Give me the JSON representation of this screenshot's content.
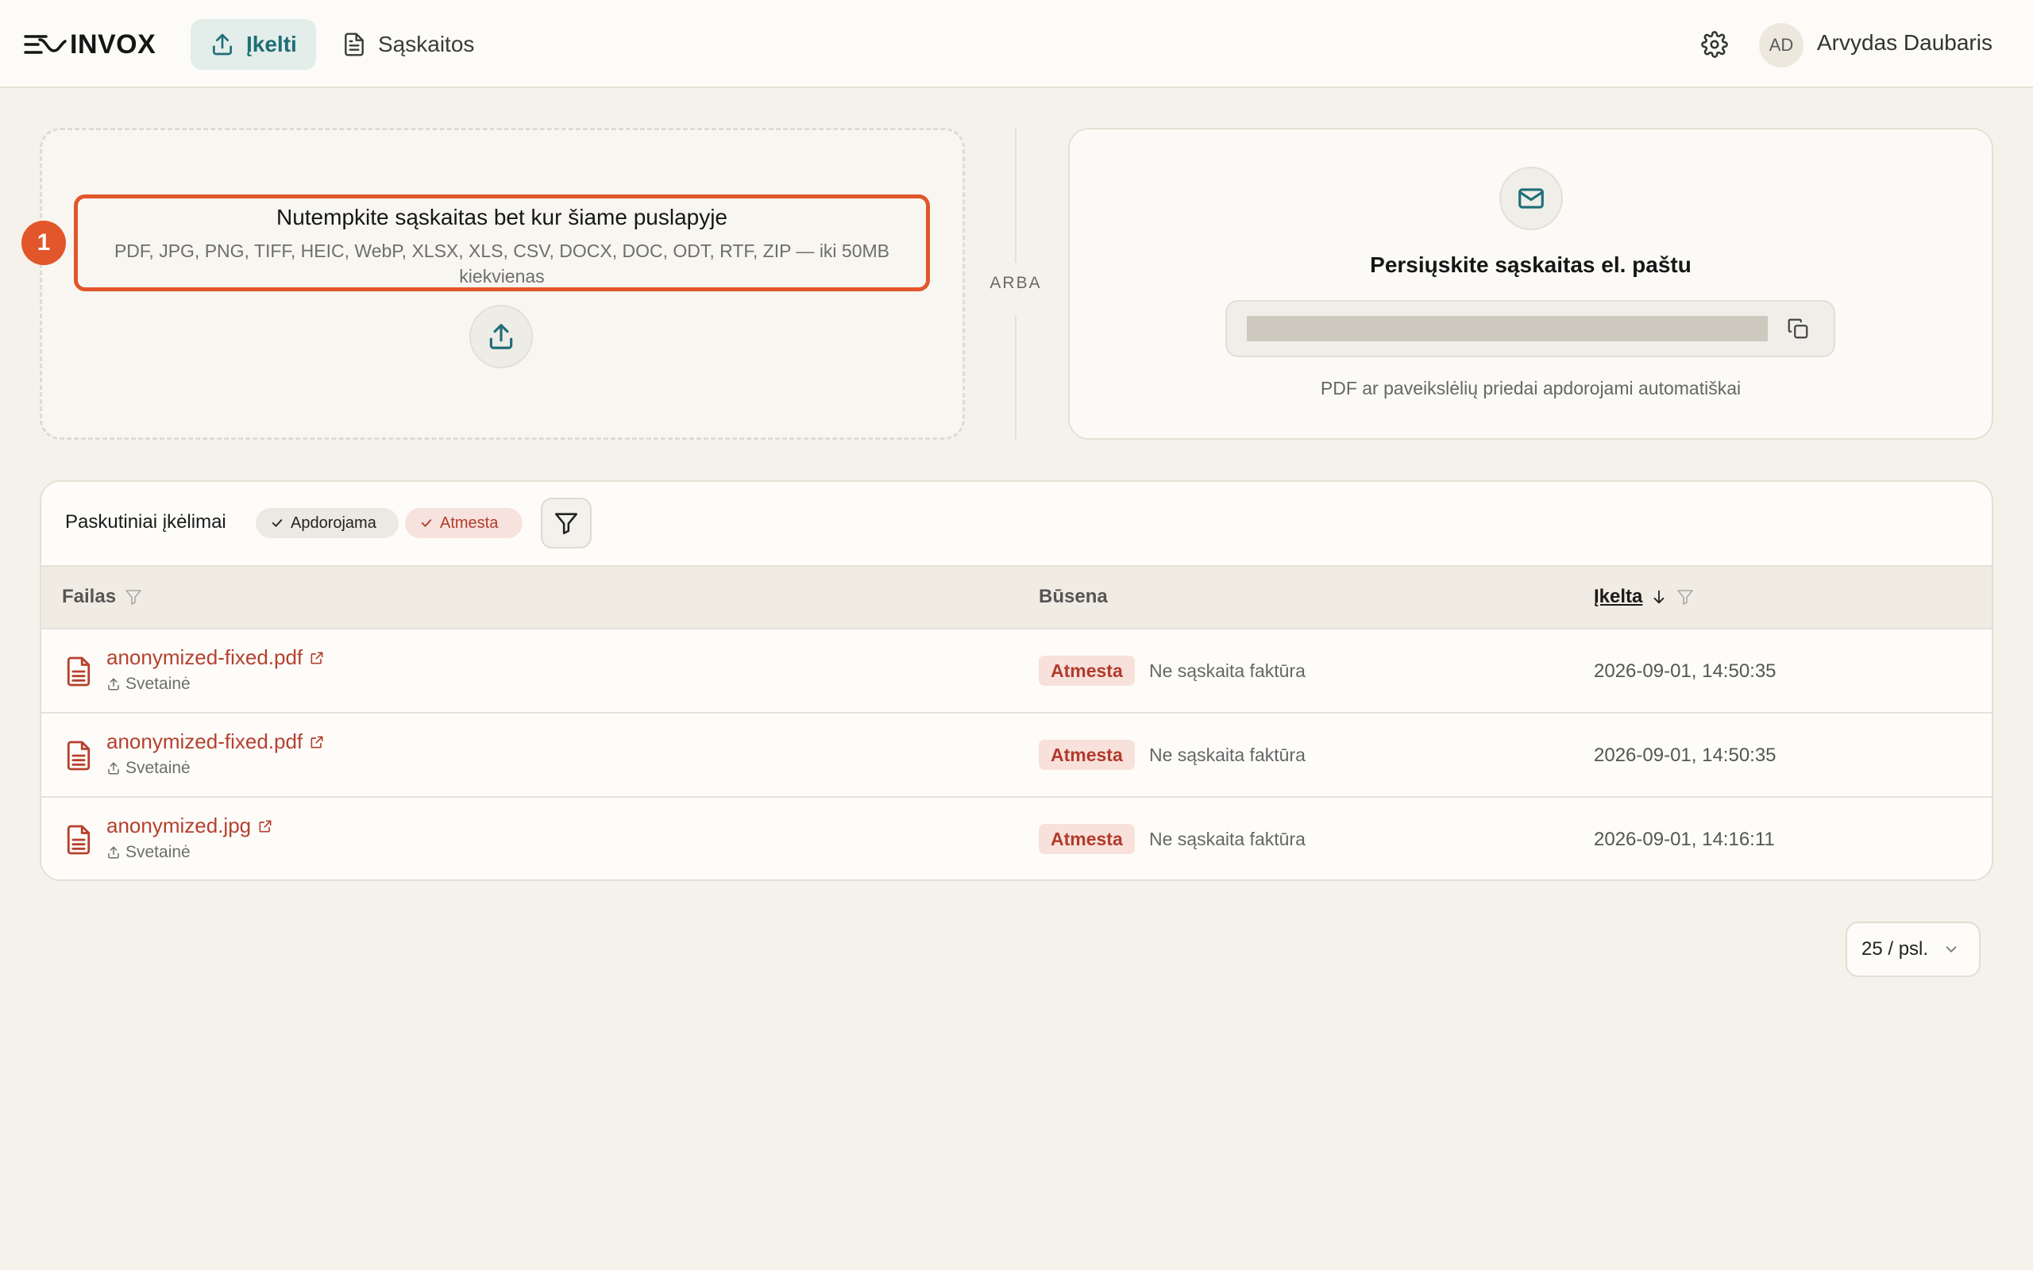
{
  "header": {
    "logo_text": "INVOX",
    "nav": [
      {
        "label": "Įkelti",
        "active": true
      },
      {
        "label": "Sąskaitos",
        "active": false
      }
    ],
    "user": {
      "initials": "AD",
      "name": "Arvydas Daubaris"
    }
  },
  "upload": {
    "step": "1",
    "title": "Nutempkite sąskaitas bet kur šiame puslapyje",
    "formats": "PDF, JPG, PNG, TIFF, HEIC, WebP, XLSX, XLS, CSV, DOCX, DOC, ODT, RTF, ZIP — iki 50MB kiekvienas",
    "or_label": "ARBA"
  },
  "email": {
    "title": "Persiųskite sąskaitas el. paštu",
    "note": "PDF ar paveikslėlių priedai apdorojami automatiškai"
  },
  "recent": {
    "title": "Paskutiniai įkėlimai",
    "chips": [
      "Apdorojama",
      "Atmesta"
    ],
    "columns": {
      "file": "Failas",
      "status": "Būsena",
      "uploaded": "Įkelta"
    },
    "rows": [
      {
        "file": "anonymized-fixed.pdf",
        "source": "Svetainė",
        "status": "Atmesta",
        "reason": "Ne sąskaita faktūra",
        "date": "2026-09-01, 14:50:35"
      },
      {
        "file": "anonymized-fixed.pdf",
        "source": "Svetainė",
        "status": "Atmesta",
        "reason": "Ne sąskaita faktūra",
        "date": "2026-09-01, 14:50:35"
      },
      {
        "file": "anonymized.jpg",
        "source": "Svetainė",
        "status": "Atmesta",
        "reason": "Ne sąskaita faktūra",
        "date": "2026-09-01, 14:16:11"
      }
    ]
  },
  "pagination": {
    "per_page": "25 / psl."
  },
  "colors": {
    "accent": "#1f6e78",
    "highlight": "#e2562b",
    "danger": "#b23a2c",
    "background": "#f5f2eb"
  }
}
